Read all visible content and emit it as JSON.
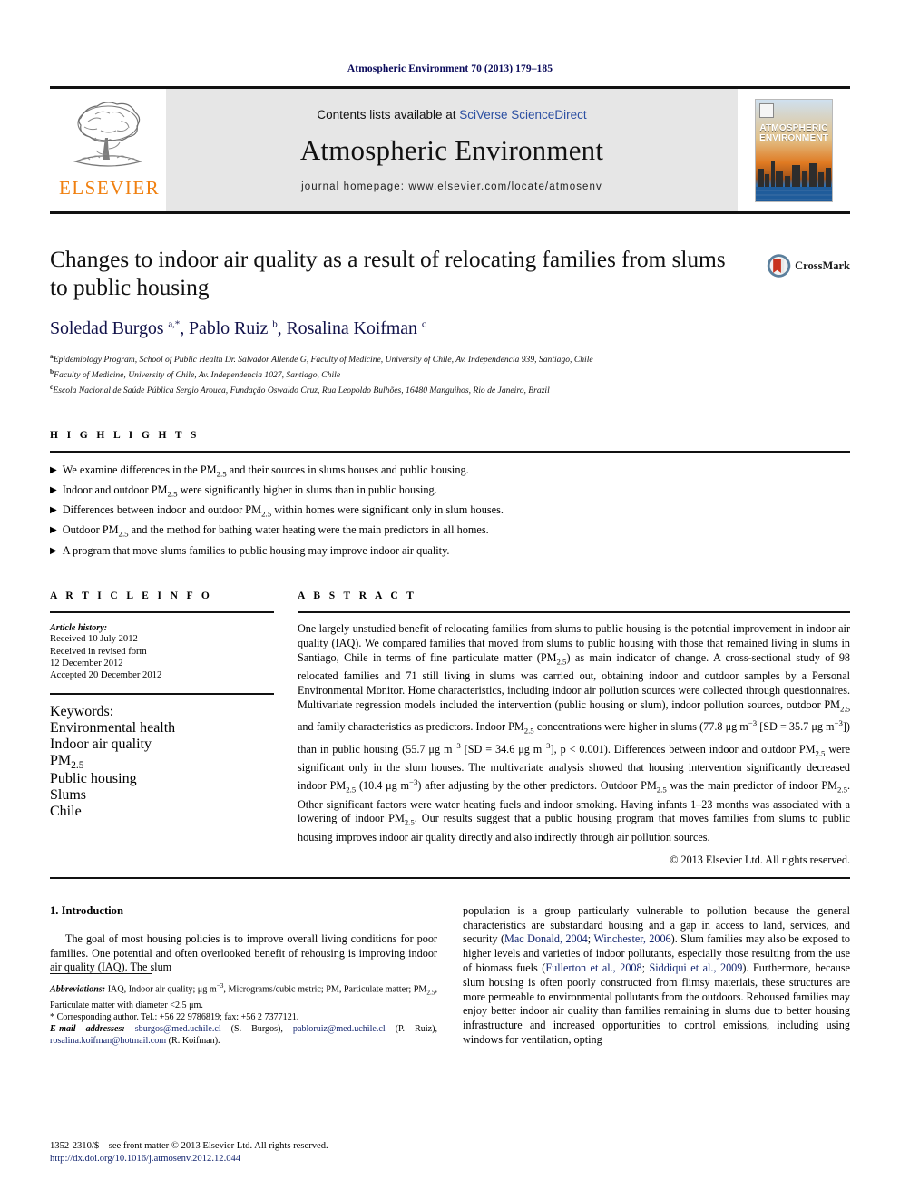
{
  "running_head": "Atmospheric Environment 70 (2013) 179–185",
  "banner": {
    "contents_prefix": "Contents lists available at ",
    "contents_link": "SciVerse ScienceDirect",
    "journal_title": "Atmospheric Environment",
    "homepage": "journal homepage: www.elsevier.com/locate/atmosenv",
    "publisher_wordmark": "ELSEVIER",
    "cover_title_line1": "ATMOSPHERIC",
    "cover_title_line2": "ENVIRONMENT"
  },
  "article": {
    "title": "Changes to indoor air quality as a result of relocating families from slums to public housing",
    "crossmark_label": "CrossMark",
    "authors_html": "Soledad Burgos <sup>a,*</sup>, Pablo Ruiz <sup>b</sup>, Rosalina Koifman <sup>c</sup>",
    "affiliations": [
      "Epidemiology Program, School of Public Health Dr. Salvador Allende G, Faculty of Medicine, University of Chile, Av. Independencia 939, Santiago, Chile",
      "Faculty of Medicine, University of Chile, Av. Independencia 1027, Santiago, Chile",
      "Escola Nacional de Saúde Pública Sergio Arouca, Fundação Oswaldo Cruz, Rua Leopoldo Bulhões, 16480 Manguihos, Rio de Janeiro, Brazil"
    ],
    "affiliation_marks": [
      "a",
      "b",
      "c"
    ]
  },
  "highlights": {
    "heading": "H I G H L I G H T S",
    "bullet_glyph": "▶",
    "items": [
      "We examine differences in the PM<sub>2.5</sub> and their sources in slums houses and public housing.",
      "Indoor and outdoor PM<sub>2.5</sub> were significantly higher in slums than in public housing.",
      "Differences between indoor and outdoor PM<sub>2.5</sub> within homes were significant only in slum houses.",
      "Outdoor PM<sub>2.5</sub> and the method for bathing water heating were the main predictors in all homes.",
      "A program that move slums families to public housing may improve indoor air quality."
    ]
  },
  "article_info": {
    "heading": "A R T I C L E    I N F O",
    "history_label": "Article history:",
    "history_lines": [
      "Received 10 July 2012",
      "Received in revised form",
      "12 December 2012",
      "Accepted 20 December 2012"
    ],
    "keywords_label": "Keywords:",
    "keywords": [
      "Environmental health",
      "Indoor air quality",
      "PM<sub>2.5</sub>",
      "Public housing",
      "Slums",
      "Chile"
    ]
  },
  "abstract": {
    "heading": "A B S T R A C T",
    "text_html": "One largely unstudied benefit of relocating families from slums to public housing is the potential improvement in indoor air quality (IAQ). We compared families that moved from slums to public housing with those that remained living in slums in Santiago, Chile in terms of fine particulate matter (PM<sub>2.5</sub>) as main indicator of change. A cross-sectional study of 98 relocated families and 71 still living in slums was carried out, obtaining indoor and outdoor samples by a Personal Environmental Monitor. Home characteristics, including indoor air pollution sources were collected through questionnaires. Multivariate regression models included the intervention (public housing or slum), indoor pollution sources, outdoor PM<sub>2.5</sub> and family characteristics as predictors. Indoor PM<sub>2.5</sub> concentrations were higher in slums (77.8 μg m<sup>−3</sup> [SD = 35.7 μg m<sup>−3</sup>]) than in public housing (55.7 μg m<sup>−3</sup> [SD = 34.6 μg m<sup>−3</sup>], p &lt; 0.001). Differences between indoor and outdoor PM<sub>2.5</sub> were significant only in the slum houses. The multivariate analysis showed that housing intervention significantly decreased indoor PM<sub>2.5</sub> (10.4 μg m<sup>−3</sup>) after adjusting by the other predictors. Outdoor PM<sub>2.5</sub> was the main predictor of indoor PM<sub>2.5</sub>. Other significant factors were water heating fuels and indoor smoking. Having infants 1–23 months was associated with a lowering of indoor PM<sub>2.5</sub>. Our results suggest that a public housing program that moves families from slums to public housing improves indoor air quality directly and also indirectly through air pollution sources.",
    "copyright": "© 2013 Elsevier Ltd. All rights reserved."
  },
  "introduction": {
    "heading": "1.  Introduction",
    "left_paragraph_html": "The goal of most housing policies is to improve overall living conditions for poor families. One potential and often overlooked benefit of rehousing is improving indoor air quality (IAQ). The slum",
    "right_paragraph_html": "population is a group particularly vulnerable to pollution because the general characteristics are substandard housing and a gap in access to land, services, and security (<span class=\"cit\">Mac Donald, 2004</span>; <span class=\"cit\">Winchester, 2006</span>). Slum families may also be exposed to higher levels and varieties of indoor pollutants, especially those resulting from the use of biomass fuels (<span class=\"cit\">Fullerton et al., 2008</span>; <span class=\"cit\">Siddiqui et al., 2009</span>). Furthermore, because slum housing is often poorly constructed from flimsy materials, these structures are more permeable to environmental pollutants from the outdoors. Rehoused families may enjoy better indoor air quality than families remaining in slums due to better housing infrastructure and increased opportunities to control emissions, including using windows for ventilation, opting"
  },
  "footnotes": {
    "abbreviations_html": "<span class=\"it\">Abbreviations:</span> IAQ, Indoor air quality; μg m<sup>−3</sup>, Micrograms/cubic metric; PM, Particulate matter; PM<sub>2.5</sub>, Particulate matter with diameter &lt;2.5 μm.",
    "corresponding_html": "* Corresponding author. Tel.: +56 22 9786819; fax: +56 2 7377121.",
    "emails_html": "<span class=\"it\">E-mail addresses:</span> <span class=\"lnk\">sburgos@med.uchile.cl</span> (S. Burgos), <span class=\"lnk\">pabloruiz@med.uchile.cl</span> (P. Ruiz), <span class=\"lnk\">rosalina.koifman@hotmail.com</span> (R. Koifman)."
  },
  "imprint": {
    "front_matter": "1352-2310/$ – see front matter © 2013 Elsevier Ltd. All rights reserved.",
    "doi": "http://dx.doi.org/10.1016/j.atmosenv.2012.12.044"
  },
  "colors": {
    "link_blue": "#12246e",
    "sciencedirect_blue": "#2b4fa2",
    "elsevier_orange": "#f08010",
    "banner_grey": "#e6e6e6"
  }
}
